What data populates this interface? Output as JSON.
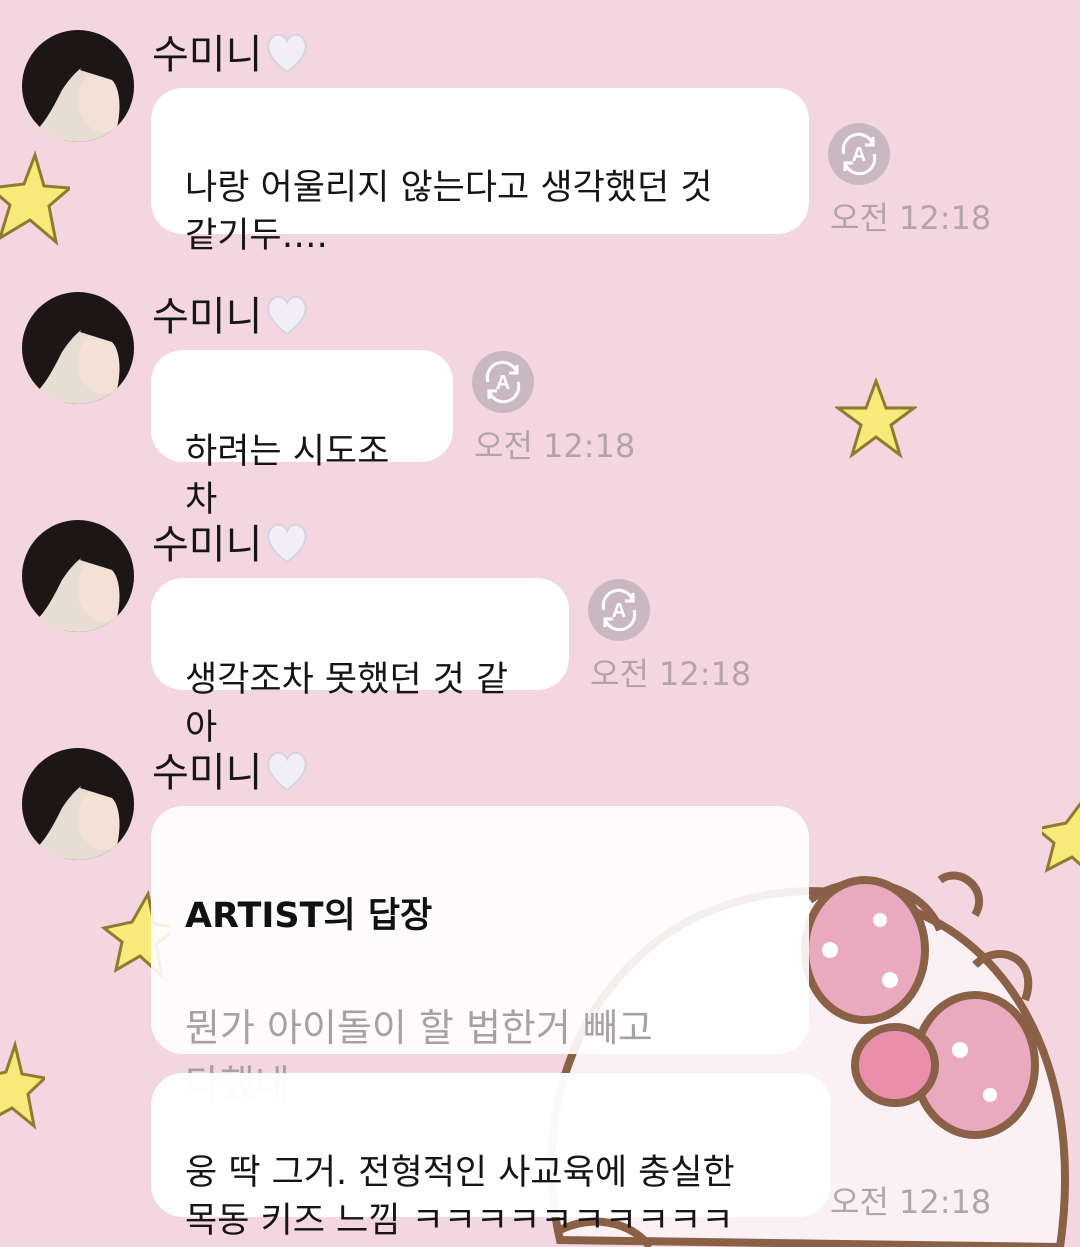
{
  "chat": {
    "sender_name": "수미니",
    "heart_emoji": "white-heart-icon",
    "messages": [
      {
        "text": "나랑 어울리지 않는다고 생각했던 것\n같기두….",
        "time": "오전 12:18"
      },
      {
        "text": "하려는 시도조차",
        "time": "오전 12:18"
      },
      {
        "text": "생각조차 못했던 것 같아",
        "time": "오전 12:18"
      }
    ],
    "reply": {
      "title": "ARTIST의 답장",
      "quoted_text": "뭔가 아이돌이 할 법한거 빼고\n다했네",
      "response_text": "웅 딱 그거. 전형적인 사교육에 충실한\n목동 키즈 느낌 ㅋㅋㅋㅋㅋㅋㅋㅋㅋㅋ",
      "time": "오전 12:18"
    }
  },
  "theme": {
    "background": "#f3d6e0",
    "bubble": "#ffffff",
    "time_color": "#b4a3ad",
    "translate_icon_bg": "#c9b8c2"
  }
}
